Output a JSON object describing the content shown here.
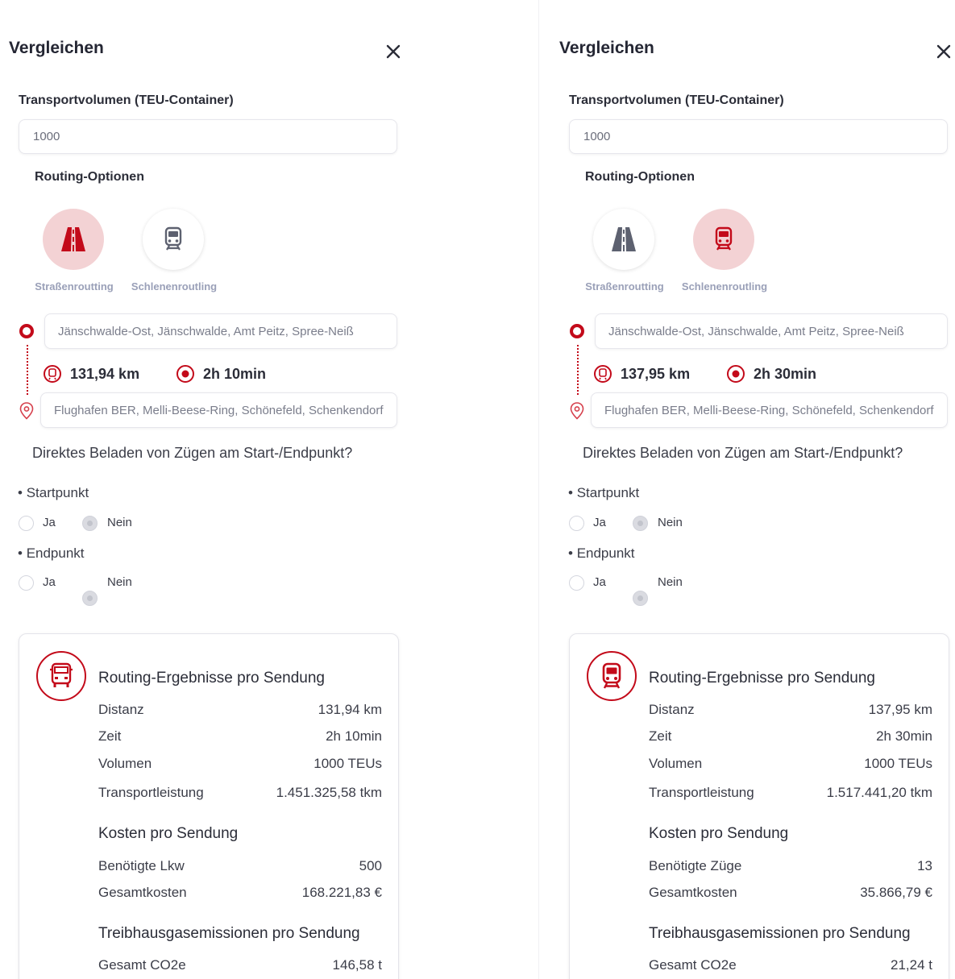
{
  "panels": [
    {
      "title": "Vergleichen",
      "volume_label": "Transportvolumen (TEU-Container)",
      "volume_value": "1000",
      "routing_options_label": "Routing-Optionen",
      "modes": [
        {
          "label": "Straßenroutting",
          "icon": "road-icon",
          "active": true
        },
        {
          "label": "Schlenenroutling",
          "icon": "train-icon",
          "active": false
        }
      ],
      "origin": "Jänschwalde-Ost, Jänschwalde, Amt Peitz, Spree-Neiß",
      "destination": "Flughafen BER, Melli-Beese-Ring, Schönefeld, Schenkendorf",
      "distance": "131,94 km",
      "duration": "2h 10min",
      "question": "Direktes Beladen von Zügen am Start-/Endpunkt?",
      "start_label": "Startpunkt",
      "end_label": "Endpunkt",
      "yes_label": "Ja",
      "no_label": "Nein",
      "card": {
        "icon": "truck-icon",
        "heading": "Routing-Ergebnisse pro Sendung",
        "rows": [
          {
            "k": "Distanz",
            "v": "131,94 km"
          },
          {
            "k": "Zeit",
            "v": "2h 10min"
          },
          {
            "k": "Volumen",
            "v": "1000 TEUs"
          },
          {
            "k": "Transportleistung",
            "v": "1.451.325,58 tkm"
          }
        ],
        "cost_heading": "Kosten pro Sendung",
        "cost_rows": [
          {
            "k": "Benötigte Lkw",
            "v": "500"
          },
          {
            "k": "Gesamtkosten",
            "v": "168.221,83 €"
          }
        ],
        "ghg_heading": "Treibhausgasemissionen pro Sendung",
        "ghg_rows": [
          {
            "k": "Gesamt CO2e",
            "v": "146,58 t"
          }
        ]
      }
    },
    {
      "title": "Vergleichen",
      "volume_label": "Transportvolumen (TEU-Container)",
      "volume_value": "1000",
      "routing_options_label": "Routing-Optionen",
      "modes": [
        {
          "label": "Straßenroutting",
          "icon": "road-icon",
          "active": false
        },
        {
          "label": "Schlenenroutling",
          "icon": "train-icon",
          "active": true
        }
      ],
      "origin": "Jänschwalde-Ost, Jänschwalde, Amt Peitz, Spree-Neiß",
      "destination": "Flughafen BER, Melli-Beese-Ring, Schönefeld, Schenkendorf",
      "distance": "137,95 km",
      "duration": "2h 30min",
      "question": "Direktes Beladen von Zügen am Start-/Endpunkt?",
      "start_label": "Startpunkt",
      "end_label": "Endpunkt",
      "yes_label": "Ja",
      "no_label": "Nein",
      "card": {
        "icon": "train-icon",
        "heading": "Routing-Ergebnisse pro Sendung",
        "rows": [
          {
            "k": "Distanz",
            "v": "137,95 km"
          },
          {
            "k": "Zeit",
            "v": "2h 30min"
          },
          {
            "k": "Volumen",
            "v": "1000 TEUs"
          },
          {
            "k": "Transportleistung",
            "v": "1.517.441,20 tkm"
          }
        ],
        "cost_heading": "Kosten pro Sendung",
        "cost_rows": [
          {
            "k": "Benötigte Züge",
            "v": "13"
          },
          {
            "k": "Gesamtkosten",
            "v": "35.866,79 €"
          }
        ],
        "ghg_heading": "Treibhausgasemissionen pro Sendung",
        "ghg_rows": [
          {
            "k": "Gesamt CO2e",
            "v": "21,24 t"
          }
        ]
      }
    }
  ],
  "colors": {
    "accent": "#c30a1a",
    "accent_soft": "#f3d2d4",
    "icon_inactive": "#5d6170",
    "mode_label": "#9aa0b8"
  }
}
